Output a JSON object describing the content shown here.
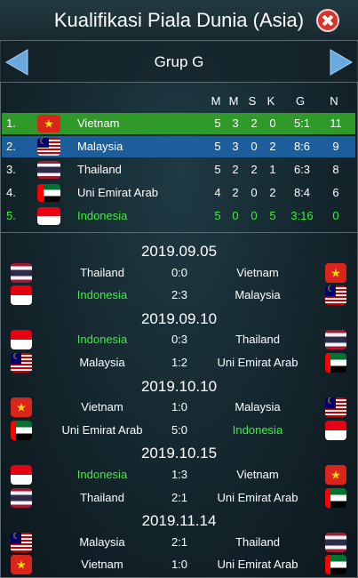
{
  "header": {
    "title": "Kualifikasi Piala Dunia (Asia)"
  },
  "group": {
    "name": "Grup G"
  },
  "standings": {
    "columns": [
      "M",
      "M",
      "S",
      "K",
      "G",
      "N"
    ],
    "rows": [
      {
        "pos": "1.",
        "team": "Vietnam",
        "flag": "vietnam-flag-icon",
        "m1": "5",
        "m2": "3",
        "s": "2",
        "k": "0",
        "g": "5:1",
        "n": "11"
      },
      {
        "pos": "2.",
        "team": "Malaysia",
        "flag": "malaysia-flag-icon",
        "m1": "5",
        "m2": "3",
        "s": "0",
        "k": "2",
        "g": "8:6",
        "n": "9"
      },
      {
        "pos": "3.",
        "team": "Thailand",
        "flag": "thailand-flag-icon",
        "m1": "5",
        "m2": "2",
        "s": "2",
        "k": "1",
        "g": "6:3",
        "n": "8"
      },
      {
        "pos": "4.",
        "team": "Uni Emirat Arab",
        "flag": "uae-flag-icon",
        "m1": "4",
        "m2": "2",
        "s": "0",
        "k": "2",
        "g": "8:4",
        "n": "6"
      },
      {
        "pos": "5.",
        "team": "Indonesia",
        "flag": "indonesia-flag-icon",
        "m1": "5",
        "m2": "0",
        "s": "0",
        "k": "5",
        "g": "3:16",
        "n": "0"
      }
    ]
  },
  "fixtures": {
    "d1": "2019.09.05",
    "d2": "2019.09.10",
    "d3": "2019.10.10",
    "d4": "2019.10.15",
    "d5": "2019.11.14",
    "m1": {
      "home": "Thailand",
      "score": "0:0",
      "away": "Vietnam"
    },
    "m2": {
      "home": "Indonesia",
      "score": "2:3",
      "away": "Malaysia"
    },
    "m3": {
      "home": "Indonesia",
      "score": "0:3",
      "away": "Thailand"
    },
    "m4": {
      "home": "Malaysia",
      "score": "1:2",
      "away": "Uni Emirat Arab"
    },
    "m5": {
      "home": "Vietnam",
      "score": "1:0",
      "away": "Malaysia"
    },
    "m6": {
      "home": "Uni Emirat Arab",
      "score": "5:0",
      "away": "Indonesia"
    },
    "m7": {
      "home": "Indonesia",
      "score": "1:3",
      "away": "Vietnam"
    },
    "m8": {
      "home": "Thailand",
      "score": "2:1",
      "away": "Uni Emirat Arab"
    },
    "m9": {
      "home": "Malaysia",
      "score": "2:1",
      "away": "Thailand"
    },
    "m10": {
      "home": "Vietnam",
      "score": "1:0",
      "away": "Uni Emirat Arab"
    }
  },
  "colors": {
    "leader_row": "#2f9a2a",
    "player_team_row": "#1c5e9c",
    "highlight_team_text": "#3cf03c",
    "close_button": "#d9332b",
    "arrow": "#6aa8e0"
  }
}
